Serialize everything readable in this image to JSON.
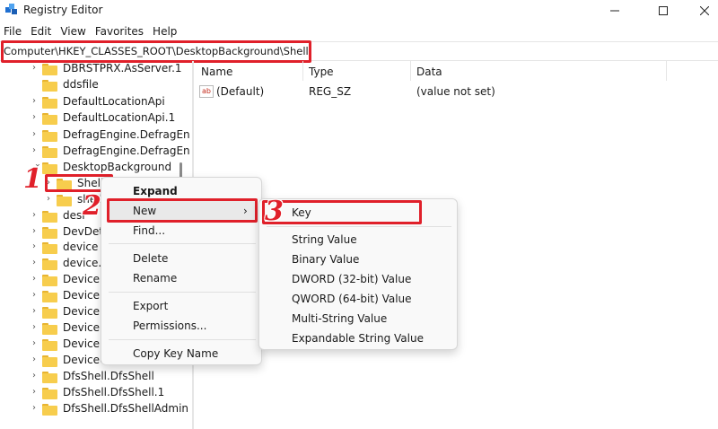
{
  "window": {
    "title": "Registry Editor"
  },
  "menubar": [
    "File",
    "Edit",
    "View",
    "Favorites",
    "Help"
  ],
  "address": "Computer\\HKEY_CLASSES_ROOT\\DesktopBackground\\Shell",
  "tree": {
    "items": [
      "DBRSTPRX.AsServer.1",
      "ddsfile",
      "DefaultLocationApi",
      "DefaultLocationApi.1",
      "DefragEngine.DefragEn",
      "DefragEngine.DefragEn",
      "DesktopBackground",
      "Shell",
      "shell",
      "desl",
      "DevDeta",
      "device",
      "device.1",
      "DeviceD",
      "DeviceM",
      "DeviceR",
      "DeviceR",
      "DeviceU",
      "DeviceU",
      "DfsShell.DfsShell",
      "DfsShell.DfsShell.1",
      "DfsShell.DfsShellAdmin"
    ]
  },
  "values": {
    "headers": {
      "name": "Name",
      "type": "Type",
      "data": "Data"
    },
    "rows": [
      {
        "name": "(Default)",
        "type": "REG_SZ",
        "data": "(value not set)"
      }
    ]
  },
  "context_menu": {
    "expand": "Expand",
    "new": "New",
    "find": "Find...",
    "delete": "Delete",
    "rename": "Rename",
    "export": "Export",
    "permissions": "Permissions...",
    "copy_key_name": "Copy Key Name"
  },
  "new_submenu": {
    "key": "Key",
    "string_value": "String Value",
    "binary_value": "Binary Value",
    "dword_value": "DWORD (32-bit) Value",
    "qword_value": "QWORD (64-bit) Value",
    "multi_string_value": "Multi-String Value",
    "expandable_string_value": "Expandable String Value"
  },
  "steps": [
    "1",
    "2",
    "3"
  ],
  "colors": {
    "annotation_red": "#e0202a",
    "folder": "#f7cd4d",
    "highlight": "#e9e9e9"
  },
  "icons": [
    "registry-editor-icon",
    "minimize-icon",
    "maximize-icon",
    "close-icon",
    "folder-icon",
    "chevron-right-icon",
    "chevron-down-icon",
    "string-value-icon"
  ]
}
